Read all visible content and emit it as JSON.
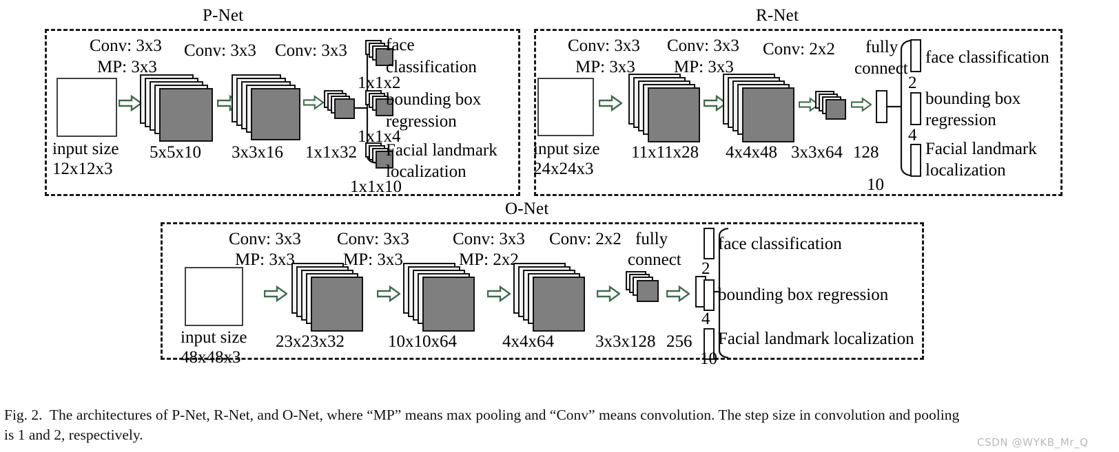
{
  "figure": {
    "caption_line1": "Fig. 2.  The architectures of P-Net, R-Net, and O-Net, where “MP” means max pooling and “Conv” means convolution. The step size in convolution and pooling",
    "caption_line2": "is 1 and 2, respectively.",
    "watermark": "CSDN @WYKB_Mr_Q",
    "colors": {
      "feature_map_fill": "#7f7f7f",
      "feature_map_back": "#f2f2f2",
      "stroke": "#111111",
      "arrow": "#3d6b4b",
      "box_dash": "#1a1a1a"
    }
  },
  "pnet": {
    "title": "P-Net",
    "input": {
      "label": "input size",
      "dims": "12x12x3"
    },
    "stages": [
      {
        "conv": "Conv: 3x3",
        "pool": "MP: 3x3",
        "dims": "5x5x10"
      },
      {
        "conv": "Conv: 3x3",
        "pool": "",
        "dims": "3x3x16"
      },
      {
        "conv": "Conv: 3x3",
        "pool": "",
        "dims": "1x1x32"
      }
    ],
    "outputs": [
      {
        "name_line1": "face",
        "name_line2": "classification",
        "dims": "1x1x2"
      },
      {
        "name_line1": "bounding box",
        "name_line2": "regression",
        "dims": "1x1x4"
      },
      {
        "name_line1": "Facial landmark",
        "name_line2": "localization",
        "dims": "1x1x10"
      }
    ]
  },
  "rnet": {
    "title": "R-Net",
    "input": {
      "label": "input size",
      "dims": "24x24x3"
    },
    "stages": [
      {
        "conv": "Conv: 3x3",
        "pool": "MP: 3x3",
        "dims": "11x11x28"
      },
      {
        "conv": "Conv: 3x3",
        "pool": "MP: 3x3",
        "dims": "4x4x48"
      },
      {
        "conv": "Conv: 2x2",
        "pool": "",
        "dims": "3x3x64"
      }
    ],
    "fully_connect_line1": "fully",
    "fully_connect_line2": "connect",
    "fc_units": "128",
    "outputs": [
      {
        "label": "face classification",
        "units": "2"
      },
      {
        "label_line1": "bounding box",
        "label_line2": "regression",
        "units": "4"
      },
      {
        "label_line1": "Facial landmark",
        "label_line2": "localization",
        "units": "10"
      }
    ]
  },
  "onet": {
    "title": "O-Net",
    "input": {
      "label": "input size",
      "dims": "48x48x3"
    },
    "stages": [
      {
        "conv": "Conv: 3x3",
        "pool": "MP: 3x3",
        "dims": "23x23x32"
      },
      {
        "conv": "Conv: 3x3",
        "pool": "MP: 3x3",
        "dims": "10x10x64"
      },
      {
        "conv": "Conv: 3x3",
        "pool": "MP: 2x2",
        "dims": "4x4x64"
      },
      {
        "conv": "Conv: 2x2",
        "pool": "",
        "dims": "3x3x128"
      }
    ],
    "fully_connect_line1": "fully",
    "fully_connect_line2": "connect",
    "fc_units": "256",
    "outputs": [
      {
        "label": "face classification",
        "units": "2"
      },
      {
        "label": "bounding box regression",
        "units": "4"
      },
      {
        "label": "Facial landmark localization",
        "units": "10"
      }
    ]
  }
}
